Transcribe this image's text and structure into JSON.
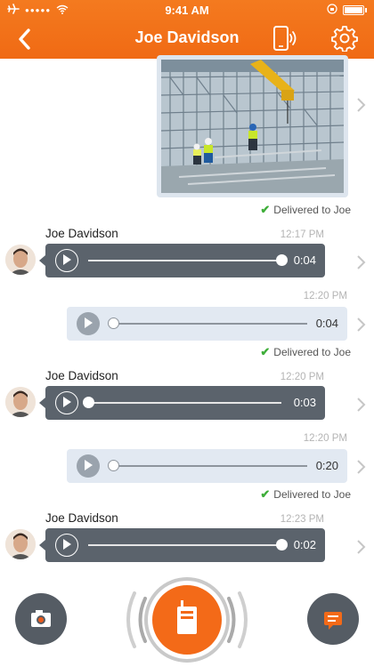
{
  "status_bar": {
    "time": "9:41 AM",
    "signal_dots": "●●●●●"
  },
  "header": {
    "title": "Joe Davidson"
  },
  "photo_message": {
    "delivered_text": "Delivered to Joe"
  },
  "messages": [
    {
      "sender": "Joe Davidson",
      "time": "12:17 PM",
      "direction": "incoming",
      "duration": "0:04",
      "progress": 1.0
    },
    {
      "time": "12:20 PM",
      "direction": "outgoing",
      "duration": "0:04",
      "progress": 0.0,
      "delivered_text": "Delivered to Joe"
    },
    {
      "sender": "Joe Davidson",
      "time": "12:20 PM",
      "direction": "incoming",
      "duration": "0:03",
      "progress": 0.0
    },
    {
      "time": "12:20 PM",
      "direction": "outgoing",
      "duration": "0:20",
      "progress": 0.0,
      "delivered_text": "Delivered to Joe"
    },
    {
      "sender": "Joe Davidson",
      "time": "12:23 PM",
      "direction": "incoming",
      "duration": "0:02",
      "progress": 1.0
    }
  ],
  "icons": {
    "back": "chevron-left-icon",
    "phone": "phone-vibrate-icon",
    "settings": "gear-icon",
    "camera": "camera-icon",
    "talk": "walkie-talkie-icon",
    "chat": "chat-bubble-icon"
  },
  "colors": {
    "brand": "#f26c17",
    "incoming_bubble": "#5b636c",
    "outgoing_bubble": "#e2e9f2",
    "delivered_check": "#3fae3a"
  }
}
